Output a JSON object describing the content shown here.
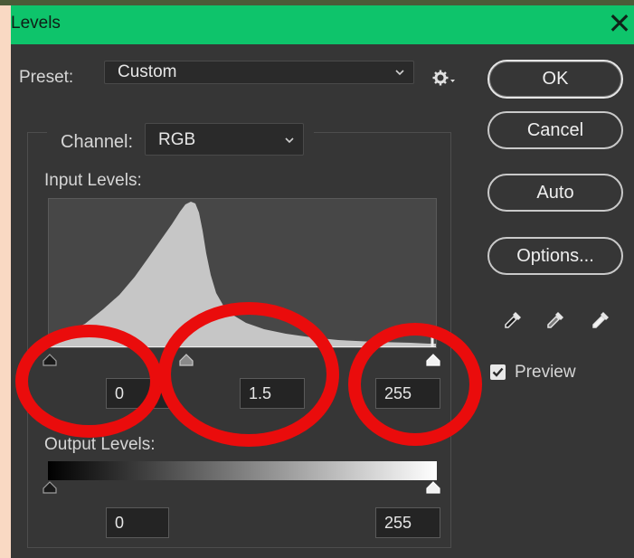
{
  "window": {
    "title": "Levels",
    "close_glyph": "✕"
  },
  "preset": {
    "label": "Preset:",
    "value": "Custom"
  },
  "channel": {
    "label": "Channel:",
    "value": "RGB"
  },
  "input_levels": {
    "label": "Input Levels:",
    "black": "0",
    "gamma": "1.5",
    "white": "255"
  },
  "output_levels": {
    "label": "Output Levels:",
    "black": "0",
    "white": "255"
  },
  "buttons": {
    "ok": "OK",
    "cancel": "Cancel",
    "auto": "Auto",
    "options": "Options..."
  },
  "preview": {
    "label": "Preview",
    "checked": true
  },
  "icons": {
    "gear": "gear-icon",
    "black_eyedropper": "black-point-eyedropper-icon",
    "gray_eyedropper": "gray-point-eyedropper-icon",
    "white_eyedropper": "white-point-eyedropper-icon"
  },
  "colors": {
    "title_bar": "#0ec46b",
    "dialog_background": "#363636",
    "annotation_ring": "#ea0c0c"
  }
}
